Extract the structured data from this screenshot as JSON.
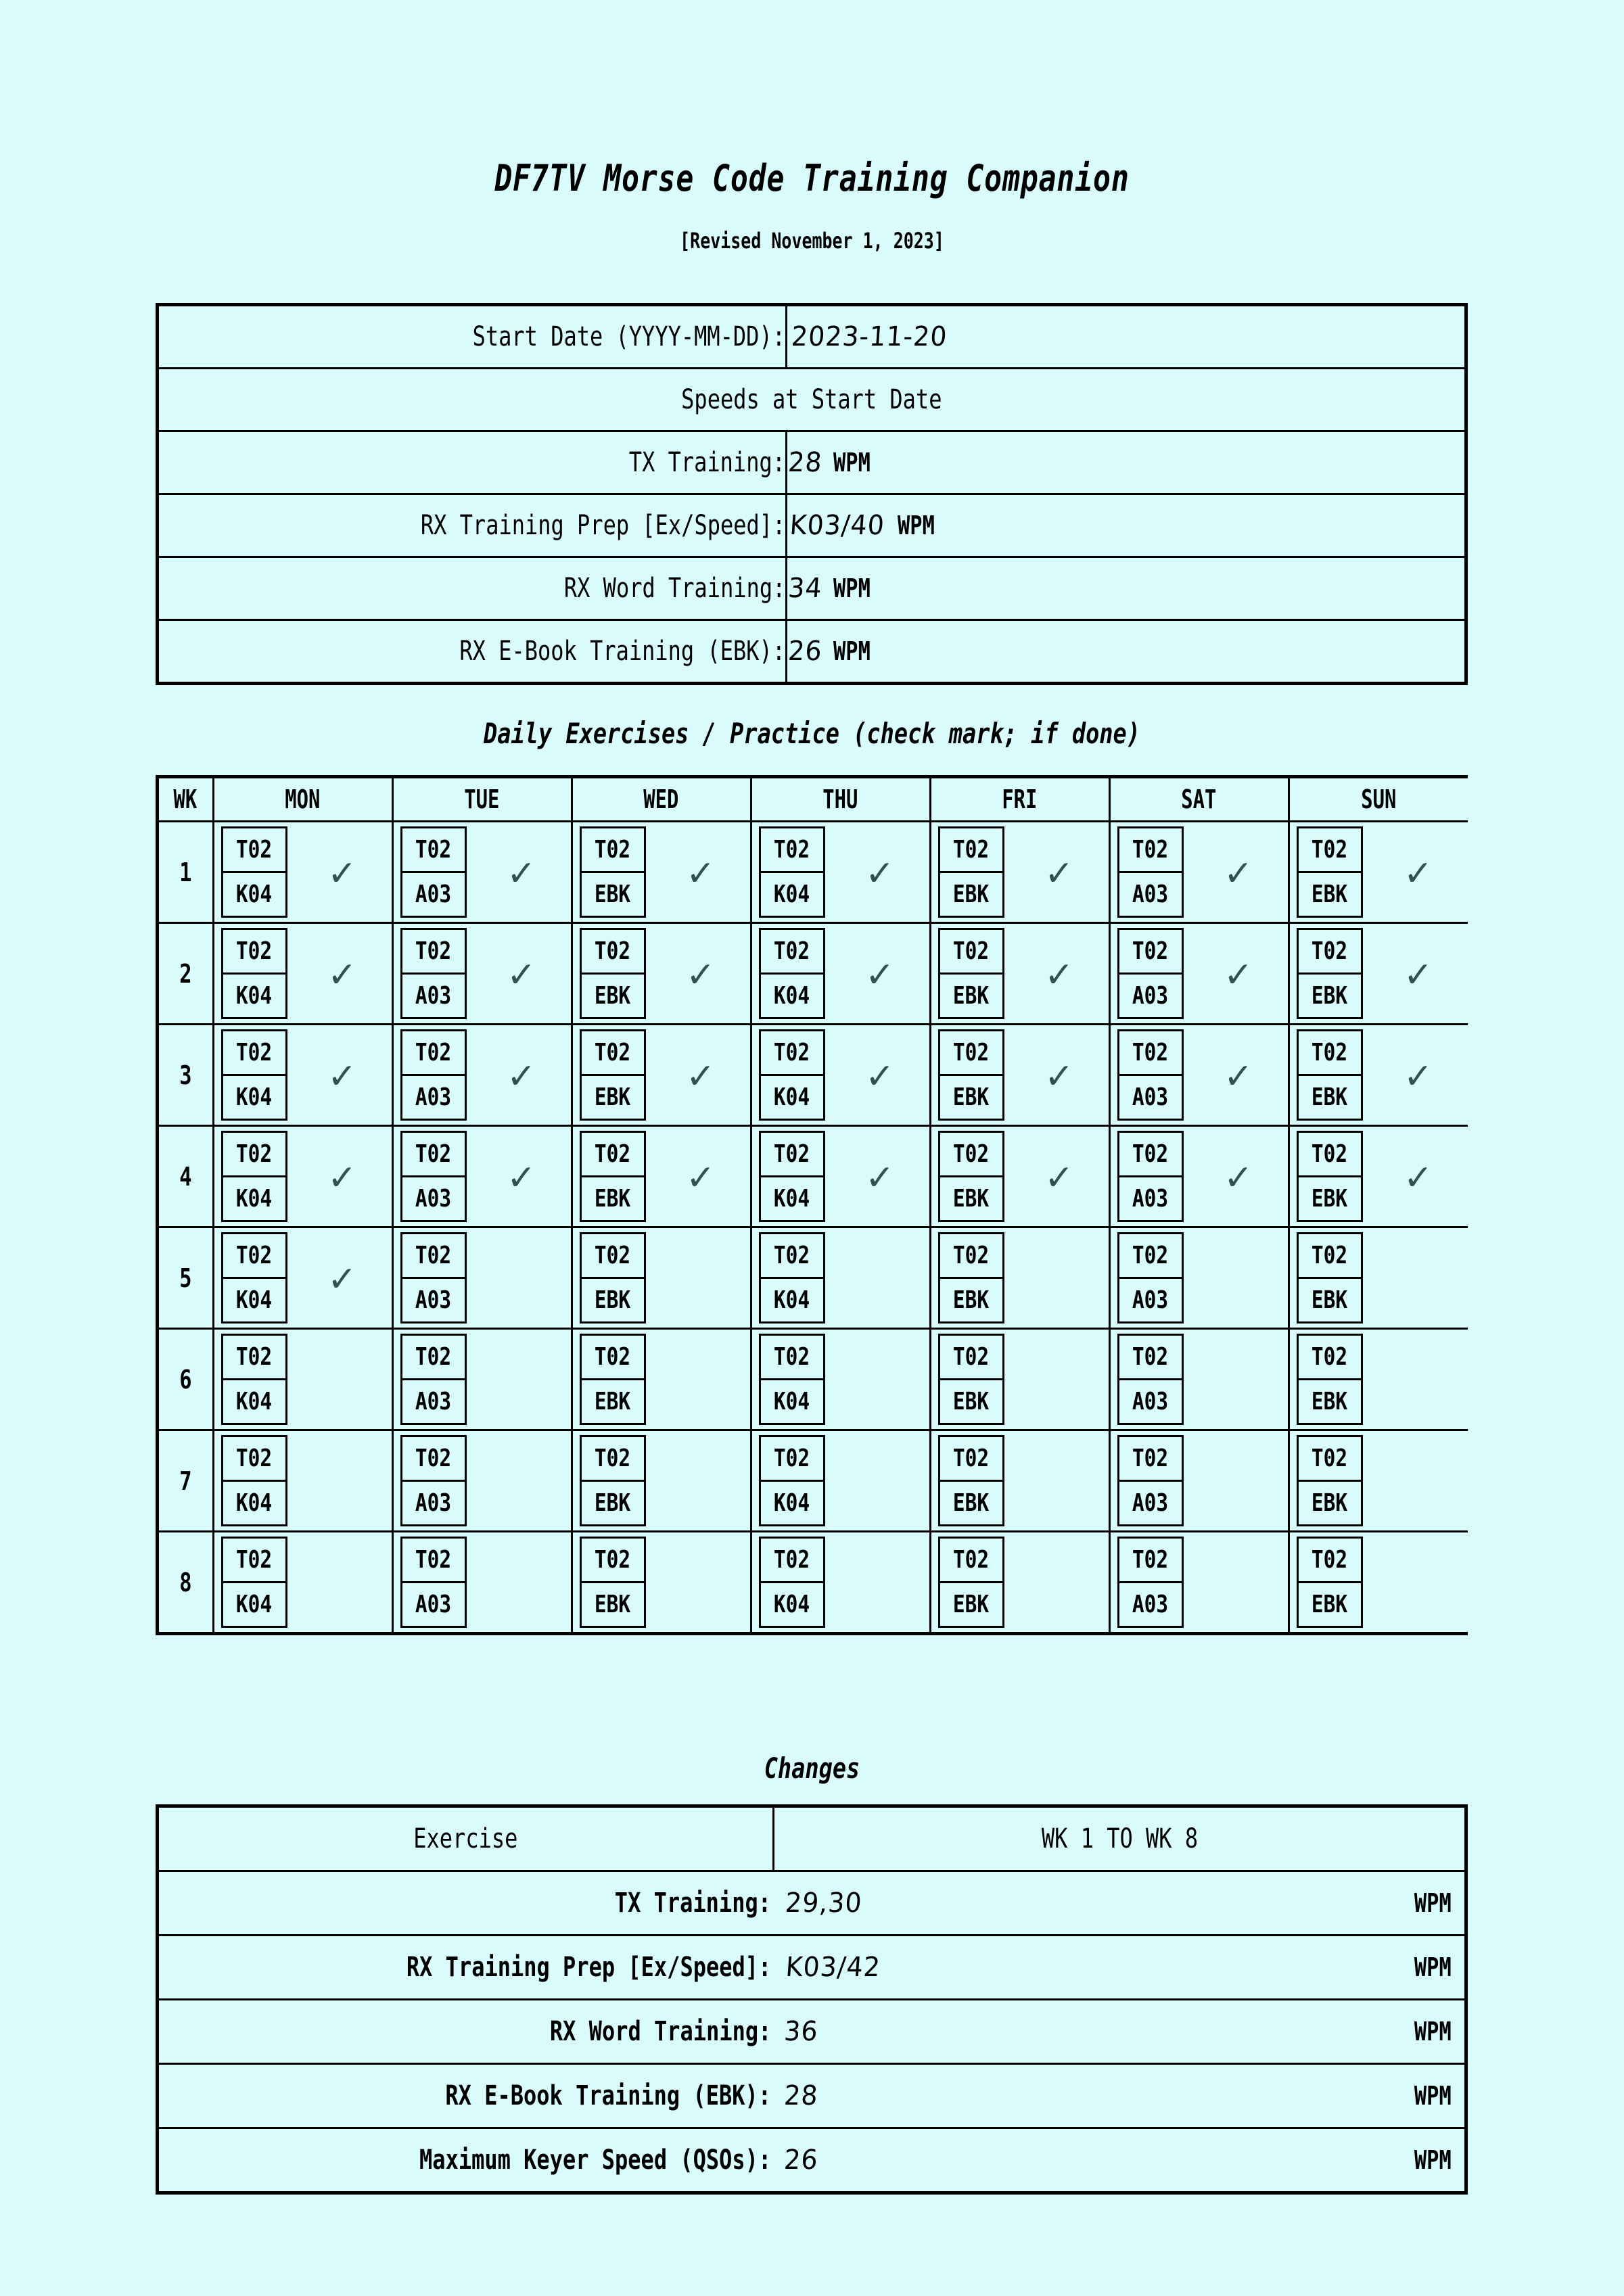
{
  "document": {
    "title": "DF7TV Morse Code Training Companion",
    "revision": "[Revised November 1, 2023]"
  },
  "settings": {
    "start_date_label": "Start Date (YYYY-MM-DD):",
    "start_date_value": "2023-11-20",
    "speeds_heading": "Speeds at Start Date",
    "unit": "WPM",
    "rows": [
      {
        "label": "TX Training:",
        "value": "28",
        "unit": "WPM"
      },
      {
        "label": "RX Training Prep [Ex/Speed]:",
        "value": "K03/40",
        "unit": "WPM"
      },
      {
        "label": "RX Word Training:",
        "value": "34",
        "unit": "WPM"
      },
      {
        "label": "RX E-Book Training (EBK):",
        "value": "26",
        "unit": "WPM"
      }
    ]
  },
  "schedule": {
    "title": "Daily Exercises / Practice (check mark; if done)",
    "check_glyph": "✓",
    "check_color": "#32504e",
    "headers": [
      "WK",
      "MON",
      "TUE",
      "WED",
      "THU",
      "FRI",
      "SAT",
      "SUN"
    ],
    "weeks": [
      {
        "wk": "1",
        "days": [
          {
            "day": "MON",
            "top": "T02",
            "bottom": "K04",
            "checked": true
          },
          {
            "day": "TUE",
            "top": "T02",
            "bottom": "A03",
            "checked": true
          },
          {
            "day": "WED",
            "top": "T02",
            "bottom": "EBK",
            "checked": true
          },
          {
            "day": "THU",
            "top": "T02",
            "bottom": "K04",
            "checked": true
          },
          {
            "day": "FRI",
            "top": "T02",
            "bottom": "EBK",
            "checked": true
          },
          {
            "day": "SAT",
            "top": "T02",
            "bottom": "A03",
            "checked": true
          },
          {
            "day": "SUN",
            "top": "T02",
            "bottom": "EBK",
            "checked": true
          }
        ]
      },
      {
        "wk": "2",
        "days": [
          {
            "day": "MON",
            "top": "T02",
            "bottom": "K04",
            "checked": true
          },
          {
            "day": "TUE",
            "top": "T02",
            "bottom": "A03",
            "checked": true
          },
          {
            "day": "WED",
            "top": "T02",
            "bottom": "EBK",
            "checked": true
          },
          {
            "day": "THU",
            "top": "T02",
            "bottom": "K04",
            "checked": true
          },
          {
            "day": "FRI",
            "top": "T02",
            "bottom": "EBK",
            "checked": true
          },
          {
            "day": "SAT",
            "top": "T02",
            "bottom": "A03",
            "checked": true
          },
          {
            "day": "SUN",
            "top": "T02",
            "bottom": "EBK",
            "checked": true
          }
        ]
      },
      {
        "wk": "3",
        "days": [
          {
            "day": "MON",
            "top": "T02",
            "bottom": "K04",
            "checked": true
          },
          {
            "day": "TUE",
            "top": "T02",
            "bottom": "A03",
            "checked": true
          },
          {
            "day": "WED",
            "top": "T02",
            "bottom": "EBK",
            "checked": true
          },
          {
            "day": "THU",
            "top": "T02",
            "bottom": "K04",
            "checked": true
          },
          {
            "day": "FRI",
            "top": "T02",
            "bottom": "EBK",
            "checked": true
          },
          {
            "day": "SAT",
            "top": "T02",
            "bottom": "A03",
            "checked": true
          },
          {
            "day": "SUN",
            "top": "T02",
            "bottom": "EBK",
            "checked": true
          }
        ]
      },
      {
        "wk": "4",
        "days": [
          {
            "day": "MON",
            "top": "T02",
            "bottom": "K04",
            "checked": true
          },
          {
            "day": "TUE",
            "top": "T02",
            "bottom": "A03",
            "checked": true
          },
          {
            "day": "WED",
            "top": "T02",
            "bottom": "EBK",
            "checked": true
          },
          {
            "day": "THU",
            "top": "T02",
            "bottom": "K04",
            "checked": true
          },
          {
            "day": "FRI",
            "top": "T02",
            "bottom": "EBK",
            "checked": true
          },
          {
            "day": "SAT",
            "top": "T02",
            "bottom": "A03",
            "checked": true
          },
          {
            "day": "SUN",
            "top": "T02",
            "bottom": "EBK",
            "checked": true
          }
        ]
      },
      {
        "wk": "5",
        "days": [
          {
            "day": "MON",
            "top": "T02",
            "bottom": "K04",
            "checked": true
          },
          {
            "day": "TUE",
            "top": "T02",
            "bottom": "A03",
            "checked": false
          },
          {
            "day": "WED",
            "top": "T02",
            "bottom": "EBK",
            "checked": false
          },
          {
            "day": "THU",
            "top": "T02",
            "bottom": "K04",
            "checked": false
          },
          {
            "day": "FRI",
            "top": "T02",
            "bottom": "EBK",
            "checked": false
          },
          {
            "day": "SAT",
            "top": "T02",
            "bottom": "A03",
            "checked": false
          },
          {
            "day": "SUN",
            "top": "T02",
            "bottom": "EBK",
            "checked": false
          }
        ]
      },
      {
        "wk": "6",
        "days": [
          {
            "day": "MON",
            "top": "T02",
            "bottom": "K04",
            "checked": false
          },
          {
            "day": "TUE",
            "top": "T02",
            "bottom": "A03",
            "checked": false
          },
          {
            "day": "WED",
            "top": "T02",
            "bottom": "EBK",
            "checked": false
          },
          {
            "day": "THU",
            "top": "T02",
            "bottom": "K04",
            "checked": false
          },
          {
            "day": "FRI",
            "top": "T02",
            "bottom": "EBK",
            "checked": false
          },
          {
            "day": "SAT",
            "top": "T02",
            "bottom": "A03",
            "checked": false
          },
          {
            "day": "SUN",
            "top": "T02",
            "bottom": "EBK",
            "checked": false
          }
        ]
      },
      {
        "wk": "7",
        "days": [
          {
            "day": "MON",
            "top": "T02",
            "bottom": "K04",
            "checked": false
          },
          {
            "day": "TUE",
            "top": "T02",
            "bottom": "A03",
            "checked": false
          },
          {
            "day": "WED",
            "top": "T02",
            "bottom": "EBK",
            "checked": false
          },
          {
            "day": "THU",
            "top": "T02",
            "bottom": "K04",
            "checked": false
          },
          {
            "day": "FRI",
            "top": "T02",
            "bottom": "EBK",
            "checked": false
          },
          {
            "day": "SAT",
            "top": "T02",
            "bottom": "A03",
            "checked": false
          },
          {
            "day": "SUN",
            "top": "T02",
            "bottom": "EBK",
            "checked": false
          }
        ]
      },
      {
        "wk": "8",
        "days": [
          {
            "day": "MON",
            "top": "T02",
            "bottom": "K04",
            "checked": false
          },
          {
            "day": "TUE",
            "top": "T02",
            "bottom": "A03",
            "checked": false
          },
          {
            "day": "WED",
            "top": "T02",
            "bottom": "EBK",
            "checked": false
          },
          {
            "day": "THU",
            "top": "T02",
            "bottom": "K04",
            "checked": false
          },
          {
            "day": "FRI",
            "top": "T02",
            "bottom": "EBK",
            "checked": false
          },
          {
            "day": "SAT",
            "top": "T02",
            "bottom": "A03",
            "checked": false
          },
          {
            "day": "SUN",
            "top": "T02",
            "bottom": "EBK",
            "checked": false
          }
        ]
      }
    ]
  },
  "changes": {
    "title": "Changes",
    "header_exercise": "Exercise",
    "header_range": "WK 1 TO WK 8",
    "rows": [
      {
        "label": "TX Training:",
        "value": "29,30",
        "unit": "WPM"
      },
      {
        "label": "RX Training Prep [Ex/Speed]:",
        "value": "K03/42",
        "unit": "WPM"
      },
      {
        "label": "RX Word Training:",
        "value": "36",
        "unit": "WPM"
      },
      {
        "label": "RX E-Book Training (EBK):",
        "value": "28",
        "unit": "WPM"
      },
      {
        "label": "Maximum Keyer Speed (QSOs):",
        "value": "26",
        "unit": "WPM"
      }
    ]
  }
}
